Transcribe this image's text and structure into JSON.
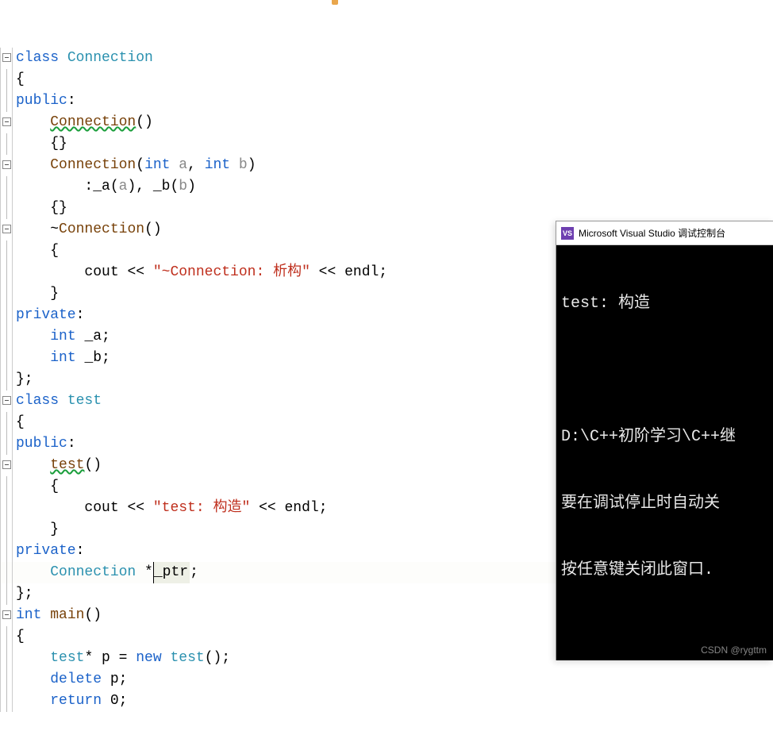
{
  "code": {
    "lines": [
      {
        "fold": "minus",
        "indent": 0,
        "tokens": [
          {
            "t": "class ",
            "c": "kw"
          },
          {
            "t": "Connection",
            "c": "type"
          }
        ]
      },
      {
        "fold": "vline",
        "indent": 0,
        "tokens": [
          {
            "t": "{",
            "c": "plain"
          }
        ]
      },
      {
        "fold": "vline",
        "indent": 0,
        "tokens": [
          {
            "t": "public",
            "c": "kw"
          },
          {
            "t": ":",
            "c": "plain"
          }
        ]
      },
      {
        "fold": "minus",
        "indent": 1,
        "tokens": [
          {
            "t": "Connection",
            "c": "fn squiggle"
          },
          {
            "t": "()",
            "c": "plain"
          }
        ]
      },
      {
        "fold": "vline",
        "indent": 1,
        "tokens": [
          {
            "t": "{}",
            "c": "plain"
          }
        ]
      },
      {
        "fold": "minus",
        "indent": 1,
        "tokens": [
          {
            "t": "Connection",
            "c": "fn"
          },
          {
            "t": "(",
            "c": "plain"
          },
          {
            "t": "int ",
            "c": "kw"
          },
          {
            "t": "a",
            "c": "param"
          },
          {
            "t": ", ",
            "c": "plain"
          },
          {
            "t": "int ",
            "c": "kw"
          },
          {
            "t": "b",
            "c": "param"
          },
          {
            "t": ")",
            "c": "plain"
          }
        ]
      },
      {
        "fold": "vline",
        "indent": 2,
        "tokens": [
          {
            "t": ":_a(",
            "c": "plain"
          },
          {
            "t": "a",
            "c": "param"
          },
          {
            "t": "), _b(",
            "c": "plain"
          },
          {
            "t": "b",
            "c": "param"
          },
          {
            "t": ")",
            "c": "plain"
          }
        ]
      },
      {
        "fold": "vline",
        "indent": 1,
        "tokens": [
          {
            "t": "{}",
            "c": "plain"
          }
        ]
      },
      {
        "fold": "minus",
        "indent": 1,
        "tokens": [
          {
            "t": "~",
            "c": "plain"
          },
          {
            "t": "Connection",
            "c": "fn"
          },
          {
            "t": "()",
            "c": "plain"
          }
        ]
      },
      {
        "fold": "vline",
        "indent": 1,
        "tokens": [
          {
            "t": "{",
            "c": "plain"
          }
        ]
      },
      {
        "fold": "vline",
        "indent": 2,
        "tokens": [
          {
            "t": "cout ",
            "c": "plain"
          },
          {
            "t": "<< ",
            "c": "op"
          },
          {
            "t": "\"~Connection: 析构\"",
            "c": "str"
          },
          {
            "t": " << ",
            "c": "op"
          },
          {
            "t": "endl;",
            "c": "plain"
          }
        ]
      },
      {
        "fold": "vline",
        "indent": 1,
        "tokens": [
          {
            "t": "}",
            "c": "plain"
          }
        ]
      },
      {
        "fold": "vline",
        "indent": 0,
        "tokens": [
          {
            "t": "private",
            "c": "kw"
          },
          {
            "t": ":",
            "c": "plain"
          }
        ]
      },
      {
        "fold": "vline",
        "indent": 1,
        "tokens": [
          {
            "t": "int ",
            "c": "kw"
          },
          {
            "t": "_a;",
            "c": "plain"
          }
        ]
      },
      {
        "fold": "vline",
        "indent": 1,
        "tokens": [
          {
            "t": "int ",
            "c": "kw"
          },
          {
            "t": "_b;",
            "c": "plain"
          }
        ]
      },
      {
        "fold": "vline",
        "indent": 0,
        "tokens": [
          {
            "t": "};",
            "c": "plain"
          }
        ]
      },
      {
        "fold": "minus",
        "indent": 0,
        "tokens": [
          {
            "t": "class ",
            "c": "kw"
          },
          {
            "t": "test",
            "c": "type"
          }
        ]
      },
      {
        "fold": "vline",
        "indent": 0,
        "tokens": [
          {
            "t": "{",
            "c": "plain"
          }
        ]
      },
      {
        "fold": "vline",
        "indent": 0,
        "tokens": [
          {
            "t": "public",
            "c": "kw"
          },
          {
            "t": ":",
            "c": "plain"
          }
        ]
      },
      {
        "fold": "minus",
        "indent": 1,
        "tokens": [
          {
            "t": "test",
            "c": "fn squiggle"
          },
          {
            "t": "()",
            "c": "plain"
          }
        ]
      },
      {
        "fold": "vline",
        "indent": 1,
        "tokens": [
          {
            "t": "{",
            "c": "plain"
          }
        ]
      },
      {
        "fold": "vline",
        "indent": 2,
        "tokens": [
          {
            "t": "cout ",
            "c": "plain"
          },
          {
            "t": "<< ",
            "c": "op"
          },
          {
            "t": "\"test: 构造\"",
            "c": "str"
          },
          {
            "t": " << ",
            "c": "op"
          },
          {
            "t": "endl;",
            "c": "plain"
          }
        ]
      },
      {
        "fold": "vline",
        "indent": 1,
        "tokens": [
          {
            "t": "}",
            "c": "plain"
          }
        ]
      },
      {
        "fold": "vline",
        "indent": 0,
        "tokens": [
          {
            "t": "private",
            "c": "kw"
          },
          {
            "t": ":",
            "c": "plain"
          }
        ]
      },
      {
        "fold": "vline",
        "indent": 1,
        "bp": true,
        "current": true,
        "tokens": [
          {
            "t": "Connection",
            "c": "type"
          },
          {
            "t": " *",
            "c": "plain"
          },
          {
            "t": "_ptr",
            "c": "plain",
            "cursor": true
          },
          {
            "t": ";",
            "c": "plain"
          }
        ]
      },
      {
        "fold": "vline",
        "indent": 0,
        "tokens": [
          {
            "t": "};",
            "c": "plain"
          }
        ]
      },
      {
        "fold": "minus",
        "indent": 0,
        "tokens": [
          {
            "t": "int ",
            "c": "kw"
          },
          {
            "t": "main",
            "c": "fn"
          },
          {
            "t": "()",
            "c": "plain"
          }
        ]
      },
      {
        "fold": "vline",
        "indent": 0,
        "tokens": [
          {
            "t": "{",
            "c": "plain"
          }
        ]
      },
      {
        "fold": "vline",
        "indent": 1,
        "bp": true,
        "tokens": [
          {
            "t": "test",
            "c": "type"
          },
          {
            "t": "* p = ",
            "c": "plain"
          },
          {
            "t": "new ",
            "c": "kw"
          },
          {
            "t": "test",
            "c": "type"
          },
          {
            "t": "();",
            "c": "plain"
          }
        ]
      },
      {
        "fold": "vline",
        "indent": 1,
        "bp": true,
        "tokens": [
          {
            "t": "delete ",
            "c": "kw"
          },
          {
            "t": "p;",
            "c": "plain"
          }
        ]
      },
      {
        "fold": "vline",
        "indent": 1,
        "tokens": [
          {
            "t": "return ",
            "c": "kw"
          },
          {
            "t": "0;",
            "c": "plain"
          }
        ]
      }
    ]
  },
  "console": {
    "title_icon": "VS",
    "title": "Microsoft Visual Studio 调试控制台",
    "out_line1": "test: 构造",
    "out_line2": "D:\\C++初阶学习\\C++继",
    "out_line3": "要在调试停止时自动关",
    "out_line4": "按任意键关闭此窗口."
  },
  "watermark": "CSDN @rygttm"
}
